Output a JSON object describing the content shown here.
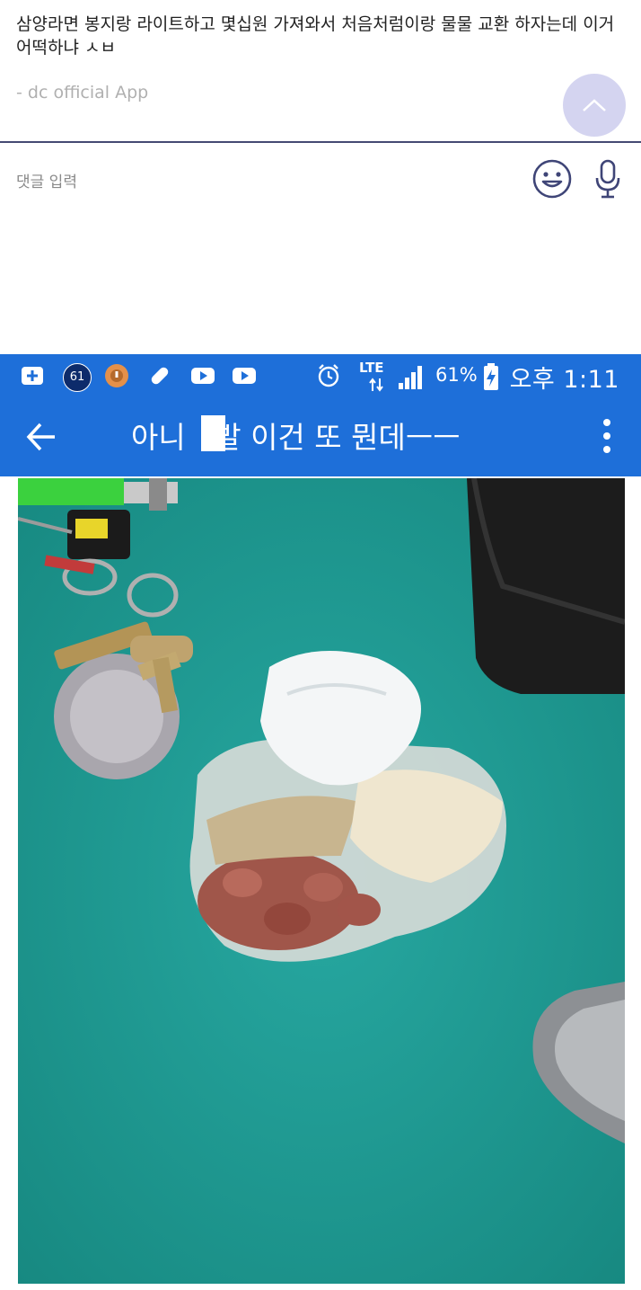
{
  "post": {
    "text": "삼양라면 봉지랑 라이트하고 몇십원 가져와서 처음처럼이랑 물물 교환 하자는데 이거 어떡하냐 ㅅㅂ",
    "source": "- dc official App"
  },
  "comment": {
    "placeholder": "댓글 입력"
  },
  "phone": {
    "status_bar": {
      "notification_count": "61",
      "network": "LTE",
      "battery": "61%",
      "time": "오후 1:11"
    },
    "app_bar": {
      "title_before": "아니",
      "title_after": "발 이건 또 뭔데ㅡㅡ"
    }
  },
  "colors": {
    "accent": "#1e6fd9",
    "divider": "#454a73",
    "scroll_button": "#d4d4f0",
    "photo_background": "#1f9d97"
  },
  "icons": [
    "chevron-up-icon",
    "smiley-icon",
    "microphone-icon",
    "plus-icon",
    "notification-badge-icon",
    "circle-alert-icon",
    "pill-icon",
    "youtube-icon",
    "alarm-icon",
    "signal-icon",
    "battery-icon",
    "back-arrow-icon",
    "more-vertical-icon"
  ]
}
